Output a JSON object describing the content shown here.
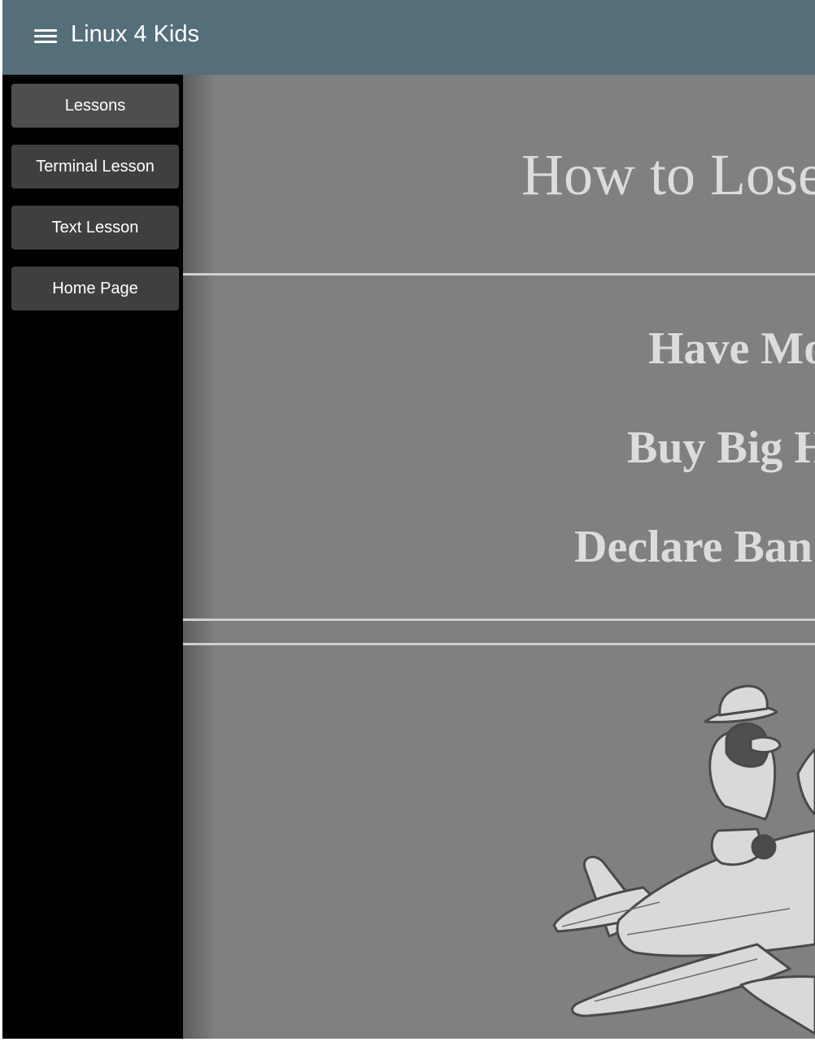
{
  "header": {
    "menu_icon": "hamburger-menu-icon",
    "title": "Linux 4 Kids"
  },
  "sidebar": {
    "items": [
      {
        "label": "Lessons"
      },
      {
        "label": "Terminal Lesson"
      },
      {
        "label": "Text Lesson"
      },
      {
        "label": "Home Page"
      }
    ]
  },
  "main": {
    "title": "How to Lose",
    "bullets": [
      "Have Mo",
      "Buy Big H",
      "Declare Ban"
    ],
    "illustration": "penguin-pilot-airplane-illustration"
  },
  "colors": {
    "header_bg": "#546e7a",
    "sidebar_bg": "#000000",
    "content_bg": "#808080",
    "text_light": "#dcdcdc"
  }
}
